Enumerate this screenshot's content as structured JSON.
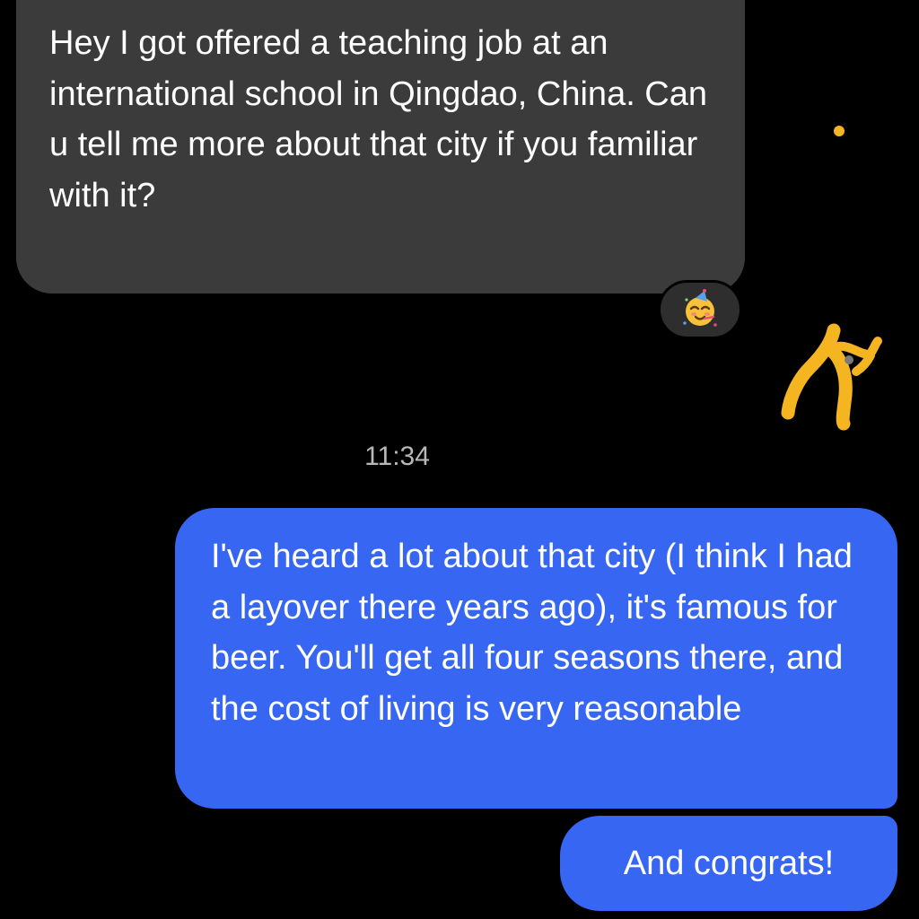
{
  "conversation": {
    "received_message": {
      "text": "Hey I got offered a teaching job at an international school in Qingdao, China. Can u tell me more about that city if you familiar with it?",
      "reaction_icon": "partying-face-emoji"
    },
    "timestamp": "11:34",
    "sent_messages": [
      {
        "text": "I've heard a lot about that city (I think I had a layover there years ago), it's famous for beer. You'll get all four seasons there, and the cost of living is very reasonable"
      },
      {
        "text": "And congrats!"
      }
    ]
  },
  "colors": {
    "background": "#000000",
    "received_bubble": "#3b3b3b",
    "sent_bubble": "#3767f2",
    "timestamp_text": "#b8b8b8",
    "overlay_scribble": "#f5b521"
  }
}
